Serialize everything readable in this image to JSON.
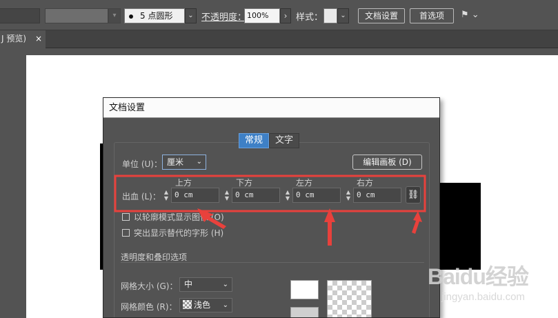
{
  "toolbar": {
    "brush_size": "5",
    "brush_shape": "点圆形",
    "opacity_label": "不透明度：",
    "opacity_value": "100%",
    "style_label": "样式：",
    "doc_setup_button": "文档设置",
    "preferences_button": "首选项"
  },
  "tabbar": {
    "doc_tab_label": "J 预览)",
    "close_glyph": "×"
  },
  "dialog": {
    "title": "文档设置",
    "tabs": [
      "常规",
      "文字"
    ],
    "unit_label": "单位 (U)：",
    "unit_value": "厘米",
    "edit_artboards_button": "编辑画板 (D)",
    "bleed_label": "出血 (L)：",
    "bleed_headers": [
      "上方",
      "下方",
      "左方",
      "右方"
    ],
    "bleed_values": [
      "0 cm",
      "0 cm",
      "0 cm",
      "0 cm"
    ],
    "checkbox_outline": "以轮廓模式显示图像 (O)",
    "checkbox_glyphs": "突出显示替代的字形 (H)",
    "transparency_section_title": "透明度和叠印选项",
    "grid_size_label": "网格大小 (G)：",
    "grid_size_value": "中",
    "grid_color_label": "网格颜色 (R)：",
    "grid_color_value": "浅色"
  },
  "watermark": {
    "brand": "Baidu经验",
    "url": "jingyan.baidu.com"
  },
  "colors": {
    "ui_gray": "#535353",
    "active_tab_blue": "#3e80c6",
    "annotation_red": "#e8413c"
  },
  "icons": [
    "chevron-down-icon",
    "close-icon",
    "chain-link-icon",
    "flag-icon",
    "spinner-arrows-icon"
  ]
}
